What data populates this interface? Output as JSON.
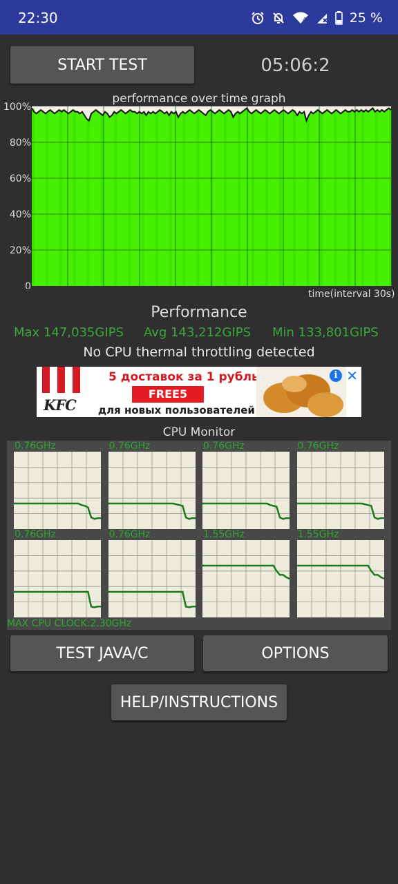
{
  "status_bar": {
    "time": "22:30",
    "icons": [
      "alarm-icon",
      "notifications-off-icon",
      "wifi-icon",
      "signal-icon",
      "battery-icon"
    ],
    "battery": "25 %"
  },
  "controls": {
    "start_label": "START TEST",
    "timer": "05:06:2"
  },
  "graph": {
    "title": "performance over time graph",
    "y_ticks": [
      "100%",
      "80%",
      "60%",
      "40%",
      "20%",
      "0"
    ],
    "x_caption": "time(interval 30s)",
    "series": [
      99,
      97,
      96,
      97,
      98,
      97,
      96,
      97,
      98,
      97,
      96,
      97,
      98,
      97,
      98,
      97,
      96,
      97,
      98,
      97,
      97,
      96,
      97,
      95,
      93,
      92,
      96,
      97,
      98,
      97,
      96,
      95,
      97,
      96,
      94,
      95,
      97,
      96,
      97,
      98,
      97,
      96,
      97,
      98,
      97,
      97,
      96,
      97,
      96,
      97,
      95,
      97,
      96,
      97,
      96,
      97,
      98,
      97,
      96,
      97,
      95,
      97,
      96,
      97,
      94,
      96,
      97,
      96,
      97,
      98,
      97,
      96,
      97,
      98,
      97,
      96,
      95,
      97,
      98,
      97,
      96,
      97,
      98,
      97,
      96,
      97,
      98,
      97,
      94,
      96,
      97,
      96,
      97,
      98,
      99,
      97,
      96,
      97,
      98,
      97,
      96,
      97,
      98,
      97,
      96,
      97,
      98,
      97,
      96,
      97,
      98,
      97,
      96,
      97,
      98,
      97,
      95,
      97,
      96,
      97,
      92,
      95,
      97,
      96,
      97,
      98,
      97,
      96,
      97,
      98,
      97,
      96,
      97,
      98,
      97,
      96,
      97,
      98,
      97,
      97,
      98,
      97,
      98,
      97,
      98,
      97,
      98,
      97,
      98,
      99,
      97,
      98,
      97,
      98,
      97,
      98,
      99,
      98
    ],
    "colors": {
      "fill": "#47f000",
      "fill_dark": "#2fd400",
      "line": "#111111",
      "background": "#f4efe4",
      "grid": "#1f5f1f"
    }
  },
  "performance": {
    "heading": "Performance",
    "max": "Max 147,035GIPS",
    "avg": "Avg 143,212GIPS",
    "min": "Min 133,801GIPS",
    "throttle": "No CPU thermal throttling detected"
  },
  "ad": {
    "logo_text": "KFC",
    "line1": "5 доставок за 1 рубль",
    "code": "FREE5",
    "line3": "для новых пользователей",
    "info_icon": "info-icon",
    "close_icon": "close-icon"
  },
  "cpu_monitor": {
    "title": "CPU Monitor",
    "cores": [
      {
        "freq": "0.76GHz",
        "curve": [
          33,
          33,
          33,
          33,
          33,
          33,
          33,
          33,
          33,
          33,
          33,
          33,
          33,
          33,
          33,
          33,
          33,
          33,
          33,
          33,
          33,
          31,
          30,
          28,
          15,
          13,
          14,
          14
        ]
      },
      {
        "freq": "0.76GHz",
        "curve": [
          33,
          33,
          33,
          33,
          33,
          33,
          33,
          33,
          33,
          33,
          33,
          33,
          33,
          33,
          33,
          33,
          33,
          33,
          33,
          33,
          33,
          32,
          31,
          30,
          15,
          13,
          14,
          14
        ]
      },
      {
        "freq": "0.76GHz",
        "curve": [
          33,
          33,
          33,
          33,
          33,
          33,
          33,
          33,
          33,
          33,
          33,
          33,
          33,
          33,
          33,
          33,
          33,
          33,
          33,
          33,
          33,
          31,
          30,
          29,
          15,
          13,
          14,
          14
        ]
      },
      {
        "freq": "0.76GHz",
        "curve": [
          33,
          33,
          33,
          33,
          33,
          33,
          33,
          33,
          33,
          33,
          33,
          33,
          33,
          33,
          33,
          33,
          33,
          33,
          33,
          33,
          33,
          32,
          31,
          30,
          15,
          13,
          14,
          14
        ]
      },
      {
        "freq": "0.76GHz",
        "curve": [
          33,
          33,
          33,
          33,
          33,
          33,
          33,
          33,
          33,
          33,
          33,
          33,
          33,
          33,
          33,
          33,
          33,
          33,
          33,
          33,
          33,
          33,
          33,
          33,
          14,
          13,
          14,
          14
        ]
      },
      {
        "freq": "0.76GHz",
        "curve": [
          33,
          33,
          33,
          33,
          33,
          33,
          33,
          33,
          33,
          33,
          33,
          33,
          33,
          33,
          33,
          33,
          33,
          33,
          33,
          33,
          33,
          33,
          33,
          33,
          14,
          13,
          14,
          14
        ]
      },
      {
        "freq": "1.55GHz",
        "curve": [
          67,
          67,
          67,
          67,
          67,
          67,
          67,
          67,
          67,
          67,
          67,
          67,
          67,
          67,
          67,
          67,
          67,
          67,
          67,
          67,
          67,
          67,
          67,
          60,
          55,
          55,
          52,
          50
        ]
      },
      {
        "freq": "1.55GHz",
        "curve": [
          67,
          67,
          67,
          67,
          67,
          67,
          67,
          67,
          67,
          67,
          67,
          67,
          67,
          67,
          67,
          67,
          67,
          67,
          67,
          67,
          67,
          67,
          67,
          60,
          55,
          55,
          52,
          50
        ]
      }
    ],
    "max_clock": "MAX CPU CLOCK:2.30GHz",
    "colors": {
      "bg": "#ecebdc",
      "grid": "#9a9a8a",
      "line": "#1a7a1a"
    }
  },
  "buttons": {
    "java": "TEST JAVA/C",
    "options": "OPTIONS",
    "help": "HELP/INSTRUCTIONS"
  }
}
